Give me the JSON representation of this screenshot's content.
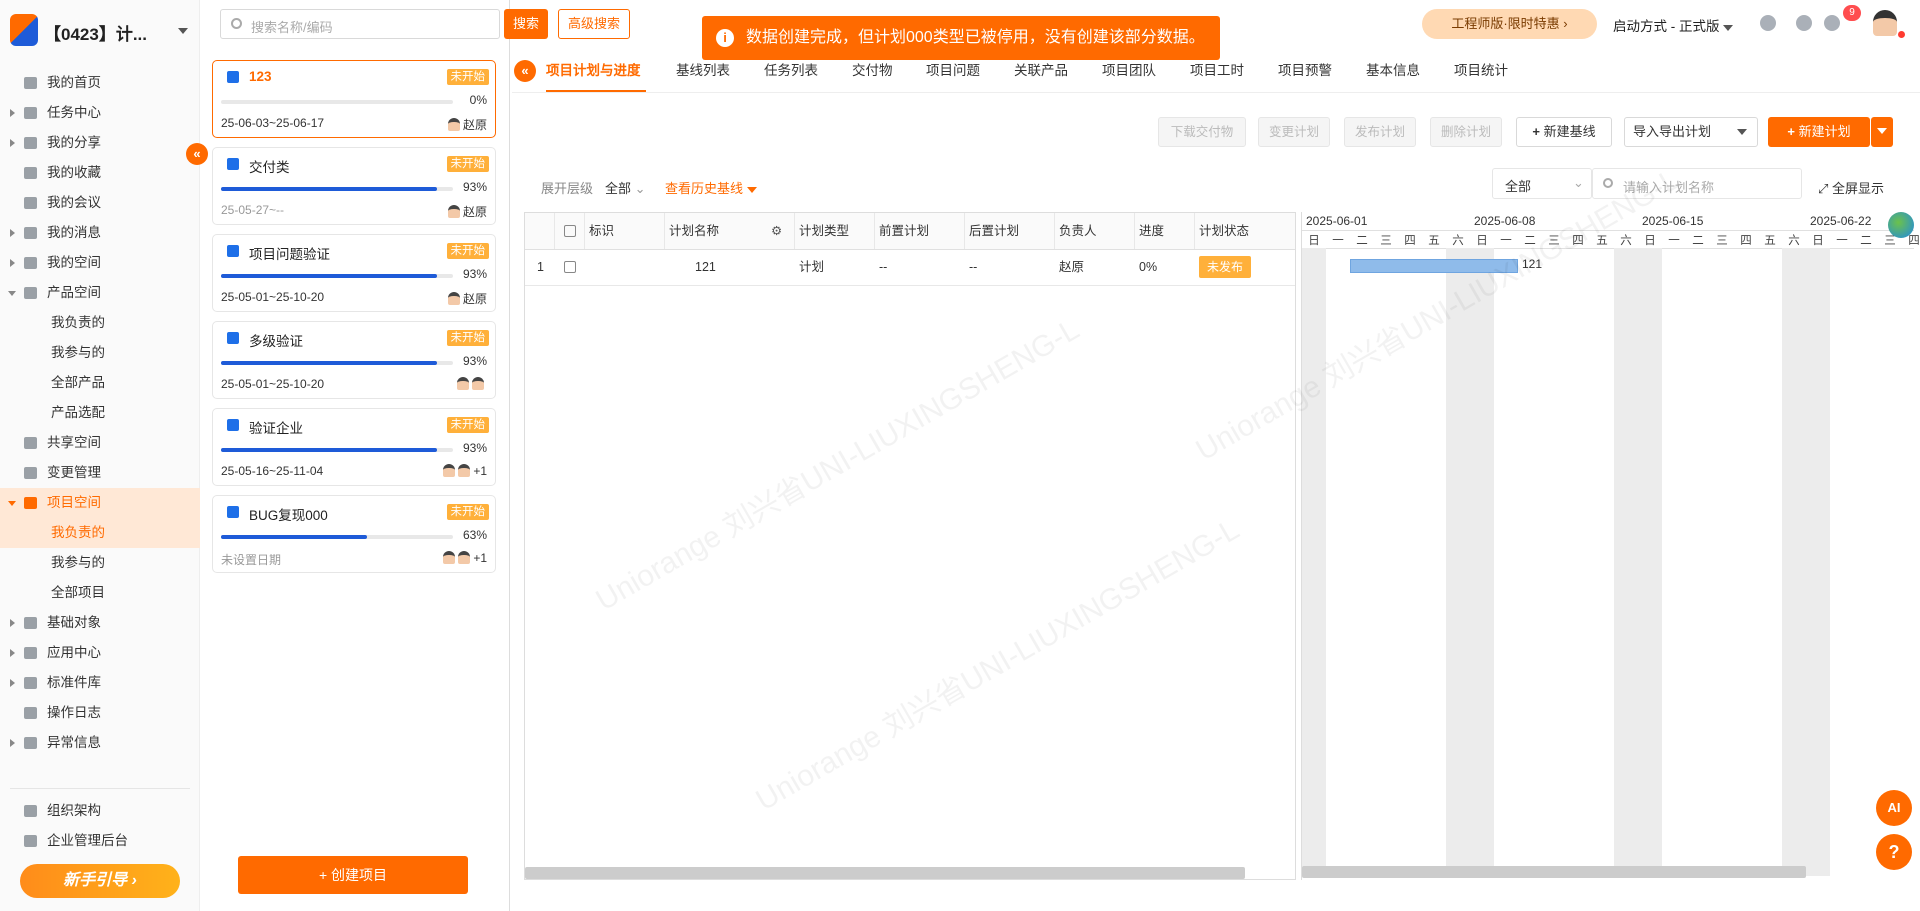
{
  "app": {
    "title": "【0423】计..."
  },
  "sidebar": {
    "items": [
      {
        "label": "我的首页"
      },
      {
        "label": "任务中心"
      },
      {
        "label": "我的分享"
      },
      {
        "label": "我的收藏"
      },
      {
        "label": "我的会议"
      },
      {
        "label": "我的消息"
      },
      {
        "label": "我的空间"
      },
      {
        "label": "产品空间"
      },
      {
        "label": "我负责的"
      },
      {
        "label": "我参与的"
      },
      {
        "label": "全部产品"
      },
      {
        "label": "产品选配"
      },
      {
        "label": "共享空间"
      },
      {
        "label": "变更管理"
      },
      {
        "label": "项目空间"
      },
      {
        "label": "我负责的"
      },
      {
        "label": "我参与的"
      },
      {
        "label": "全部项目"
      },
      {
        "label": "基础对象"
      },
      {
        "label": "应用中心"
      },
      {
        "label": "标准件库"
      },
      {
        "label": "操作日志"
      },
      {
        "label": "异常信息"
      }
    ],
    "bottom": [
      {
        "label": "组织架构"
      },
      {
        "label": "企业管理后台"
      }
    ],
    "guide_label": "新手引导"
  },
  "search": {
    "placeholder": "搜索名称/编码",
    "search_label": "搜索",
    "advanced_label": "高级搜索"
  },
  "projects": [
    {
      "name": "123",
      "status": "未开始",
      "progress": 0,
      "pct": "0%",
      "date": "25-06-03~25-06-17",
      "owner": "赵原"
    },
    {
      "name": "交付类",
      "status": "未开始",
      "progress": 93,
      "pct": "93%",
      "date": "25-05-27~--",
      "owner": "赵原"
    },
    {
      "name": "项目问题验证",
      "status": "未开始",
      "progress": 93,
      "pct": "93%",
      "date": "25-05-01~25-10-20",
      "owner": "赵原"
    },
    {
      "name": "多级验证",
      "status": "未开始",
      "progress": 93,
      "pct": "93%",
      "date": "25-05-01~25-10-20",
      "owner": ""
    },
    {
      "name": "验证企业",
      "status": "未开始",
      "progress": 93,
      "pct": "93%",
      "date": "25-05-16~25-11-04",
      "owner": "+1"
    },
    {
      "name": "BUG复现000",
      "status": "未开始",
      "progress": 63,
      "pct": "63%",
      "date": "未设置日期",
      "owner": "+1"
    }
  ],
  "create_project_label": "创建项目",
  "header": {
    "promo": "工程师版·限时特惠",
    "launch": "启动方式 - 正式版",
    "notif_count": "9"
  },
  "toast": {
    "message": "数据创建完成，但计划000类型已被停用，没有创建该部分数据。"
  },
  "tabs": [
    "项目计划与进度",
    "基线列表",
    "任务列表",
    "交付物",
    "项目问题",
    "关联产品",
    "项目团队",
    "项目工时",
    "项目预警",
    "基本信息",
    "项目统计"
  ],
  "actions": {
    "download": "下载交付物",
    "change": "变更计划",
    "publish": "发布计划",
    "delete": "删除计划",
    "new_baseline": "新建基线",
    "import_export": "导入导出计划",
    "new_plan": "新建计划"
  },
  "filter": {
    "level_label": "展开层级",
    "level_value": "全部",
    "history": "查看历史基线",
    "scope": "全部",
    "name_placeholder": "请输入计划名称",
    "fullscreen": "全屏显示"
  },
  "grid": {
    "columns": [
      "标识",
      "计划名称",
      "计划类型",
      "前置计划",
      "后置计划",
      "负责人",
      "进度",
      "计划状态"
    ],
    "rows": [
      {
        "index": "1",
        "flag": "",
        "name": "121",
        "type": "计划",
        "pre": "--",
        "post": "--",
        "owner": "赵原",
        "progress": "0%",
        "status": "未发布"
      }
    ]
  },
  "gantt": {
    "weeks": [
      "2025-06-01",
      "2025-06-08",
      "2025-06-15",
      "2025-06-22"
    ],
    "days": [
      "日",
      "一",
      "二",
      "三",
      "四",
      "五",
      "六"
    ],
    "bar_label": "121"
  },
  "watermark": "Uniorange 刘兴省UNI-LIUXINGSHENG-L"
}
